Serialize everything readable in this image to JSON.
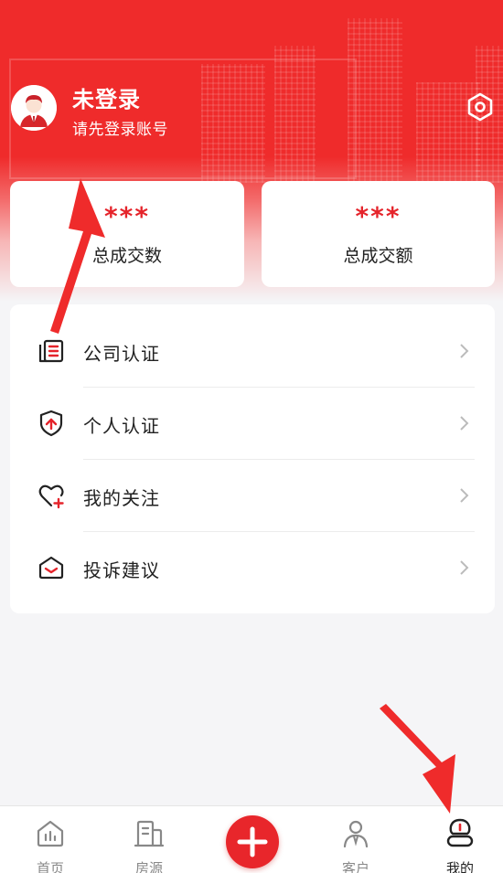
{
  "header": {
    "title": "未登录",
    "subtitle": "请先登录账号",
    "settings_icon": "settings-icon"
  },
  "stats": [
    {
      "value": "***",
      "label": "总成交数"
    },
    {
      "value": "***",
      "label": "总成交额"
    }
  ],
  "menu": [
    {
      "label": "公司认证",
      "icon": "company-cert-icon"
    },
    {
      "label": "个人认证",
      "icon": "personal-cert-icon"
    },
    {
      "label": "我的关注",
      "icon": "favorites-icon"
    },
    {
      "label": "投诉建议",
      "icon": "complaint-icon"
    }
  ],
  "tabbar": {
    "items": [
      {
        "label": "首页",
        "icon": "home-icon"
      },
      {
        "label": "房源",
        "icon": "listings-icon"
      },
      {
        "label": "客户",
        "icon": "customer-icon"
      },
      {
        "label": "我的",
        "icon": "mine-icon",
        "active": true
      }
    ],
    "fab_icon": "plus-icon"
  },
  "colors": {
    "brand_red": "#ef2b2b",
    "accent_red": "#e5242b",
    "background": "#f5f5f7"
  }
}
